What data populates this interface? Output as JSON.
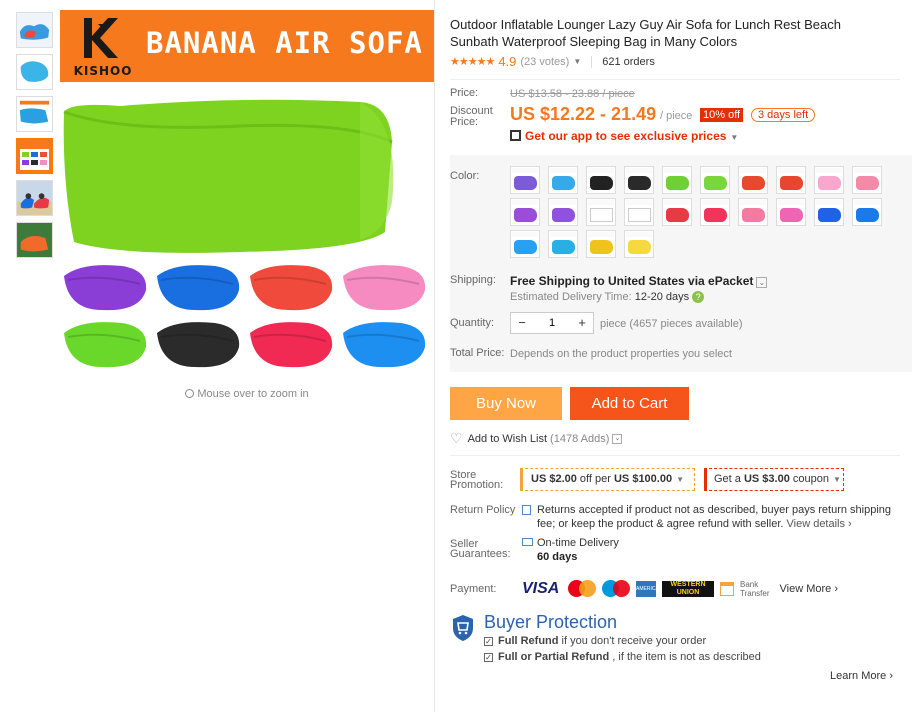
{
  "gallery": {
    "banner_brand": "KISHOO",
    "banner_title": "BANANA AIR SOFA",
    "zoom_hint": "Mouse over to zoom in",
    "thumb_count": 6,
    "main_color": "#7ed321",
    "tile_colors": [
      "#8a3ed6",
      "#1a6fe0",
      "#f04a3c",
      "#f68bc1",
      "#6ad82a",
      "#2b2b2b",
      "#f02a52",
      "#1c8ff0"
    ]
  },
  "product": {
    "title": "Outdoor Inflatable Lounger Lazy Guy Air Sofa for Lunch Rest Beach Sunbath Waterproof Sleeping Bag in Many Colors",
    "stars": "★★★★★",
    "rating": "4.9",
    "votes": "(23 votes)",
    "orders": "621 orders"
  },
  "pricing": {
    "price_label": "Price:",
    "old_price": "US $13.58 - 23.88 / piece",
    "discount_label_1": "Discount",
    "discount_label_2": "Price:",
    "price": "US $12.22 - 21.49",
    "unit": "/ piece",
    "off": "10% off",
    "days_left": "3 days left",
    "app_promo": "Get our app to see exclusive prices",
    "accent_color": "#f7791e"
  },
  "color": {
    "label": "Color:",
    "swatches": [
      "#7b5bd6",
      "#37a8e8",
      "#222222",
      "#2a2a2a",
      "#6ed032",
      "#7ad63a",
      "#e64a2e",
      "#e8462e",
      "#f9a7cf",
      "#f58aa8",
      "#9a4ed8",
      "#8e52dc",
      "#ffffff",
      "#ffffff",
      "#e63a44",
      "#f2335a",
      "#f37aa0",
      "#f064b4",
      "#1f62e6",
      "#1c7ae8",
      "#2aa0f0",
      "#2aaee6",
      "#f0c21c",
      "#f6d840"
    ]
  },
  "shipping": {
    "label": "Shipping:",
    "text": "Free Shipping to United States via ePacket",
    "est_label": "Estimated Delivery Time:",
    "est_value": "12-20 days"
  },
  "quantity": {
    "label": "Quantity:",
    "value": "1",
    "minus": "−",
    "plus": "+",
    "available": "piece (4657 pieces available)"
  },
  "total": {
    "label": "Total Price:",
    "note": "Depends on the product properties you select"
  },
  "actions": {
    "buy_now": "Buy Now",
    "add_to_cart": "Add to Cart",
    "wishlist": "Add to Wish List",
    "wishlist_count": "(1478 Adds)"
  },
  "store_promotion": {
    "label_1": "Store",
    "label_2": "Promotion:",
    "promo_1_a": "US $2.00",
    "promo_1_b": " off per ",
    "promo_1_c": "US $100.00",
    "promo_2_a": "Get a ",
    "promo_2_b": "US $3.00",
    "promo_2_c": " coupon"
  },
  "return_policy": {
    "label": "Return Policy",
    "text": "Returns accepted if product not as described, buyer pays return shipping fee; or keep the product & agree refund with seller.",
    "link": "View details"
  },
  "guarantees": {
    "label_1": "Seller",
    "label_2": "Guarantees:",
    "line_1": "On-time Delivery",
    "line_2": "60 days"
  },
  "payment": {
    "label": "Payment:",
    "visa": "VISA",
    "amex": "AMERICAN EXPRESS",
    "wu_1": "WESTERN",
    "wu_2": "UNION",
    "bank_1": "Bank",
    "bank_2": "Transfer",
    "view_more": "View More"
  },
  "buyer_protection": {
    "title": "Buyer Protection",
    "line_1_bold": "Full Refund",
    "line_1_rest": " if you don't receive your order",
    "line_2_bold": "Full or Partial Refund",
    "line_2_rest": " , if the item is not as described",
    "learn_more": "Learn More"
  }
}
